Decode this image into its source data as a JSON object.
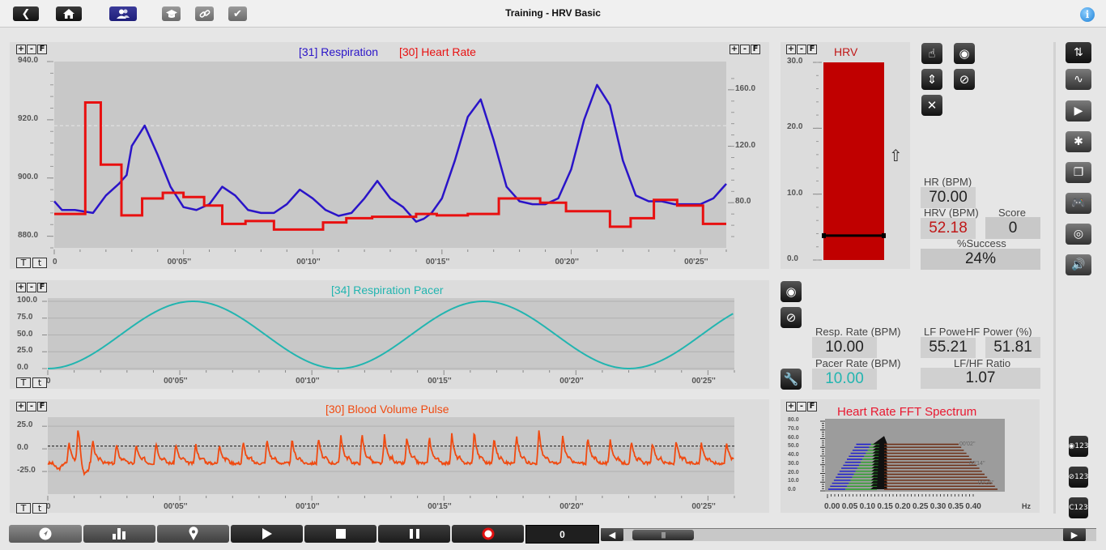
{
  "app": {
    "title": "Training - HRV Basic",
    "toolbar": [
      {
        "name": "back",
        "icon": "‹"
      },
      {
        "name": "home",
        "icon": "⌂"
      },
      {
        "name": "users",
        "icon": "👥"
      },
      {
        "name": "training",
        "icon": "🎓"
      },
      {
        "name": "link",
        "icon": "🔗"
      },
      {
        "name": "check",
        "icon": "✔"
      }
    ],
    "info_icon": "i"
  },
  "zoom_controls": {
    "plus": "+",
    "minus": "-",
    "fit": "F"
  },
  "time_controls": {
    "T": "T",
    "t": "t"
  },
  "colors": {
    "respiration": "#2a14c8",
    "heart_rate": "#e81010",
    "pacer": "#22b5b0",
    "bvp": "#f04a10",
    "hrv_bar": "#c00000",
    "hrv_value": "#c01818",
    "pacer_value": "#22b5b0"
  },
  "chart_data": [
    {
      "type": "line",
      "id": "resp_hr",
      "title_left": "[31] Respiration",
      "title_right": "[30] Heart Rate",
      "x_tick_labels": [
        "0",
        "00'05''",
        "00'10''",
        "00'15''",
        "00'20''",
        "00'25''"
      ],
      "x_ticks": [
        0,
        5,
        10,
        15,
        20,
        25
      ],
      "xlim": [
        0,
        26
      ],
      "y_left_ticks": [
        "940.0",
        "920.0",
        "900.0",
        "880.0"
      ],
      "ylim_left": [
        876,
        940
      ],
      "y_right_ticks": [
        "160.0",
        "120.0",
        "80.0"
      ],
      "ylim_right": [
        48,
        180
      ],
      "threshold_left": 918,
      "series": [
        {
          "name": "[31] Respiration",
          "axis": "left",
          "x": [
            0,
            0.3,
            0.8,
            1.5,
            2.0,
            2.5,
            2.8,
            3.0,
            3.5,
            4.0,
            4.5,
            5.0,
            5.5,
            6.0,
            6.5,
            7.0,
            7.5,
            8.0,
            8.5,
            9.0,
            9.5,
            10.0,
            10.5,
            11.0,
            11.5,
            12.0,
            12.5,
            13.0,
            13.5,
            14.0,
            14.3,
            14.6,
            15.0,
            15.5,
            16.0,
            16.5,
            17.0,
            17.5,
            18.0,
            18.5,
            19.0,
            19.5,
            20.0,
            20.5,
            21.0,
            21.5,
            22.0,
            22.5,
            23.0,
            23.5,
            24.0,
            24.5,
            25.0,
            25.5,
            26.0
          ],
          "y": [
            892,
            889,
            889,
            888,
            894,
            898,
            901,
            911,
            918,
            908,
            897,
            890,
            889,
            891,
            897,
            894,
            889,
            888,
            888,
            891,
            896,
            893,
            889,
            887,
            888,
            893,
            899,
            893,
            890,
            885,
            886,
            888,
            893,
            906,
            921,
            927,
            913,
            897,
            892,
            891,
            891,
            893,
            903,
            920,
            932,
            925,
            906,
            894,
            892,
            892,
            891,
            891,
            891,
            893,
            898
          ]
        },
        {
          "name": "[30] Heart Rate",
          "axis": "right",
          "x": [
            0,
            1.2,
            1.2,
            1.8,
            1.8,
            2.6,
            2.6,
            3.4,
            3.4,
            4.2,
            4.2,
            5.0,
            5.0,
            5.8,
            5.8,
            6.5,
            6.5,
            7.4,
            7.4,
            8.5,
            8.5,
            10.4,
            10.4,
            11.3,
            11.3,
            12.3,
            12.3,
            14.0,
            14.0,
            14.8,
            14.8,
            16.0,
            16.0,
            17.2,
            17.2,
            18.8,
            18.8,
            19.8,
            19.8,
            21.5,
            21.5,
            22.3,
            22.3,
            23.2,
            23.2,
            24.1,
            24.1,
            25.1,
            25.1,
            26.0
          ],
          "y": [
            72,
            72,
            151,
            151,
            107,
            107,
            71,
            71,
            83,
            83,
            87,
            87,
            84,
            84,
            78,
            78,
            65,
            65,
            67,
            67,
            61,
            61,
            66,
            66,
            69,
            69,
            70,
            70,
            72,
            72,
            71,
            71,
            72,
            72,
            83,
            83,
            80,
            80,
            74,
            74,
            63,
            63,
            69,
            69,
            82,
            82,
            78,
            78,
            65,
            65
          ]
        }
      ]
    },
    {
      "type": "line",
      "id": "pacer",
      "title": "[34] Respiration Pacer",
      "x_tick_labels": [
        "0",
        "00'05''",
        "00'10''",
        "00'15''",
        "00'20''",
        "00'25''"
      ],
      "x_ticks": [
        0,
        5,
        10,
        15,
        20,
        25
      ],
      "xlim": [
        0,
        26
      ],
      "y_ticks": [
        "100.0",
        "75.0",
        "50.0",
        "25.0",
        "0.0"
      ],
      "ylim": [
        0,
        100
      ],
      "series": [
        {
          "name": "[34] Respiration Pacer",
          "function": "sine",
          "period_s": 11,
          "phase_s": 0,
          "min": 0,
          "max": 100
        }
      ]
    },
    {
      "type": "line",
      "id": "bvp",
      "title": "[30] Blood Volume Pulse",
      "x_tick_labels": [
        "0",
        "00'05''",
        "00'10''",
        "00'15''",
        "00'20''",
        "00'25''"
      ],
      "x_ticks": [
        0,
        5,
        10,
        15,
        20,
        25
      ],
      "xlim": [
        0,
        26
      ],
      "y_ticks": [
        "25.0",
        "0.0",
        "-25.0"
      ],
      "ylim": [
        -50,
        35
      ],
      "threshold": 3,
      "series": [
        {
          "name": "[30] Blood Volume Pulse",
          "beat_times": [
            0.8,
            1.15,
            1.7,
            2.6,
            3.35,
            4.1,
            4.85,
            5.6,
            6.5,
            7.4,
            8.3,
            9.25,
            10.25,
            11.1,
            11.9,
            12.75,
            13.6,
            14.45,
            15.3,
            16.15,
            16.9,
            17.75,
            18.6,
            19.5,
            20.45,
            21.3,
            22.1,
            22.9,
            23.8,
            24.75,
            25.7
          ],
          "beat_peaks": [
            8,
            21,
            9,
            5,
            5,
            8,
            6,
            6,
            6,
            8,
            11,
            11,
            13,
            16,
            17,
            15,
            14,
            14,
            16,
            20,
            14,
            16,
            20,
            15,
            14,
            11,
            8,
            8,
            9,
            8,
            9
          ],
          "baseline": -16
        }
      ]
    },
    {
      "type": "bar",
      "id": "hrv_bar",
      "title": "HRV",
      "y_ticks": [
        "30.0",
        "20.0",
        "10.0",
        "0.0"
      ],
      "ylim": [
        0,
        30
      ],
      "value": 30,
      "threshold": 3.7
    },
    {
      "type": "area",
      "id": "fft",
      "title": "Heart Rate FFT Spectrum",
      "x_tick_labels": [
        "0.00",
        "0.05",
        "0.10",
        "0.15",
        "0.20",
        "0.25",
        "0.30",
        "0.35",
        "0.40"
      ],
      "xlabel": "Hz",
      "y_ticks": [
        "80.0",
        "70.0",
        "60.0",
        "50.0",
        "40.0",
        "30.0",
        "20.0",
        "10.0",
        "0.0"
      ],
      "ylim": [
        0,
        80
      ],
      "time_labels": [
        "00'02''",
        "00'14''",
        "00'26''"
      ],
      "bands": [
        {
          "name": "VLF",
          "range": [
            0.0,
            0.04
          ],
          "color": "#1a1ad0"
        },
        {
          "name": "LF",
          "range": [
            0.04,
            0.15
          ],
          "color": "#2aa02a"
        },
        {
          "name": "HF",
          "range": [
            0.15,
            0.4
          ],
          "color": "#6b2a10"
        }
      ],
      "peak_hz": 0.15,
      "peak_value": 65
    }
  ],
  "stats": {
    "hr_label": "HR (BPM)",
    "hr_value": "70.00",
    "hrv_label": "HRV (BPM)",
    "hrv_value": "52.18",
    "score_label": "Score",
    "score_value": "0",
    "success_label": "%Success",
    "success_value": "24%",
    "resp_label": "Resp. Rate (BPM)",
    "resp_value": "10.00",
    "pacer_label": "Pacer Rate (BPM)",
    "pacer_value": "10.00",
    "lf_label": "LF Power (%)",
    "lf_value": "55.21",
    "hf_label": "HF Power (%)",
    "hf_value": "51.81",
    "ratio_label": "LF/HF Ratio",
    "ratio_value": "1.07"
  },
  "hrv_arrow": "⇧",
  "bottom": {
    "counter": "0",
    "buttons": [
      "navigate",
      "bar-chart",
      "location",
      "play",
      "stop",
      "pause",
      "record"
    ]
  }
}
